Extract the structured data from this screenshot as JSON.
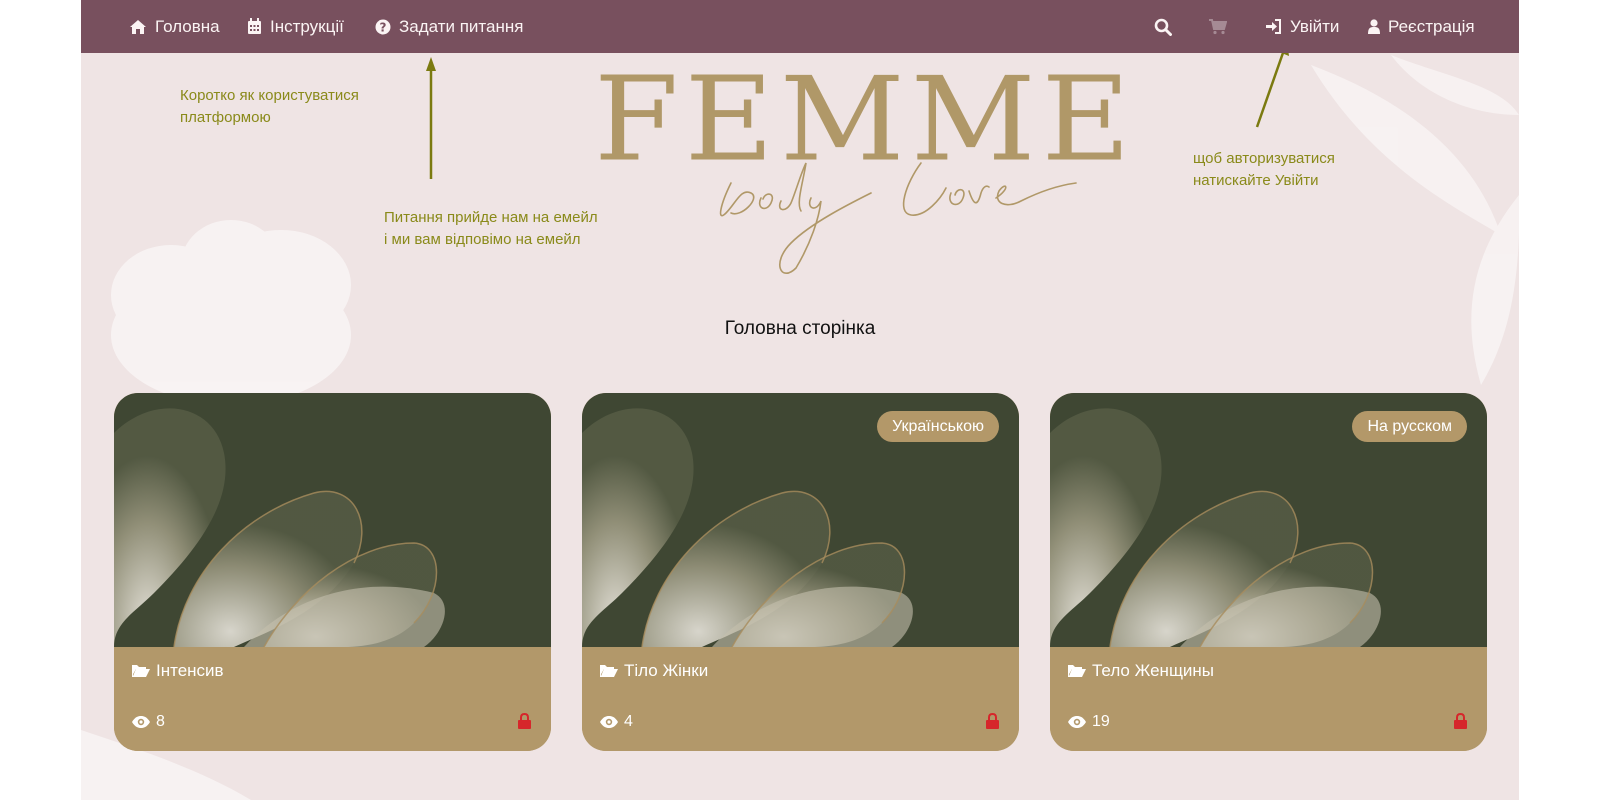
{
  "nav": {
    "home": "Головна",
    "instructions": "Інструкції",
    "ask_question": "Задати питання",
    "login": "Увійти",
    "register": "Реєстрація",
    "icons": [
      "home-icon",
      "calendar-icon",
      "question-circle-icon",
      "search-icon",
      "cart-icon",
      "sign-in-icon",
      "user-icon"
    ]
  },
  "annotations": {
    "instructions_line1": "Коротко як користуватися",
    "instructions_line2": "платформою",
    "question_line1": "Питання прийде нам на емейл",
    "question_line2": "і ми вам відповімо на емейл",
    "login_line1": "щоб авторизуватися",
    "login_line2": "натискайте Увійти"
  },
  "logo": {
    "main": "FEMME",
    "script": "body love"
  },
  "main": {
    "title": "Головна сторінка"
  },
  "cards": [
    {
      "title": "Інтенсив",
      "views": "8",
      "badge": ""
    },
    {
      "title": "Тіло Жінки",
      "views": "4",
      "badge": "Українською"
    },
    {
      "title": "Тело Женщины",
      "views": "19",
      "badge": "На русском"
    }
  ],
  "colors": {
    "navbar": "#78505e",
    "page_bg": "#efe4e4",
    "card_footer": "#b2986a",
    "card_image": "#3f4733",
    "annotation": "#8a8a1a",
    "lock": "#d6262b"
  }
}
